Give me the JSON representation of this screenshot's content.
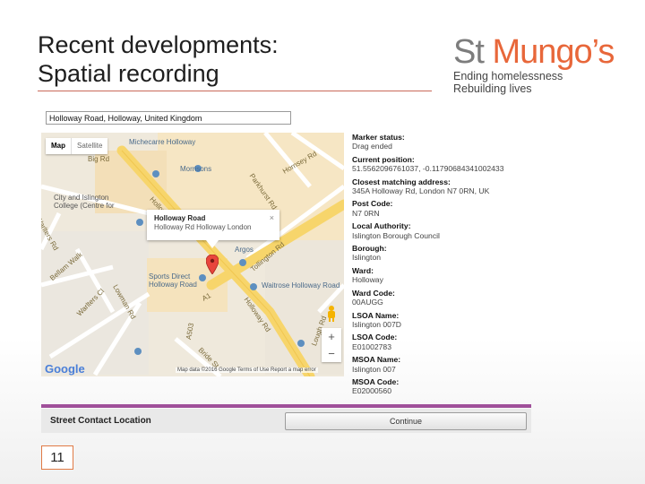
{
  "slide": {
    "title_line1": "Recent developments:",
    "title_line2": "Spatial recording",
    "page_number": "11"
  },
  "logo": {
    "word_st": "St ",
    "word_mungo": "Mungo’s",
    "tag1": "Ending homelessness",
    "tag2": "Rebuilding lives",
    "color_grey": "#7d7d7d",
    "color_orange": "#e8673a"
  },
  "search": {
    "value": "Holloway Road, Holloway, United Kingdom"
  },
  "map": {
    "type_map": "Map",
    "type_satellite": "Satellite",
    "labels": {
      "michecarre": "Michecarre Holloway",
      "morrisons": "Morrisons",
      "big_rd": "Big Rd",
      "city_islington": "City and Islington",
      "college": "College (Centre for",
      "warlters_rd": "Warlters Rd",
      "bellam": "Bellam Walk",
      "sports_direct": "Sports Direct",
      "sports_direct2": "Holloway Road",
      "argos": "Argos",
      "waitrose": "Waitrose Holloway Road",
      "tollington": "Tollington Rd",
      "holloway_rd": "Holloway Rd",
      "holloway_rd2": "Holloway Rd",
      "a1": "A1",
      "a503": "A503",
      "warlters2": "Warlters Cl",
      "parkhurst": "Parkhurst Rd",
      "hornsey": "Hornsey Rd",
      "lowman": "Lowman Rd",
      "bride": "Bride St",
      "lough": "Lough Rd"
    },
    "popup_title": "Holloway Road",
    "popup_sub": "Holloway Rd Holloway London",
    "popup_close": "×",
    "zoom_in": "+",
    "zoom_out": "−",
    "google": "Google",
    "attribution": "Map data ©2016 Google   Terms of Use   Report a map error"
  },
  "info": {
    "marker_status_label": "Marker status:",
    "marker_status_value": "Drag ended",
    "current_position_label": "Current position:",
    "current_position_value": "51.5562096761037, -0.11790684341002433",
    "closest_label": "Closest matching address:",
    "closest_value": "345A Holloway Rd, London N7 0RN, UK",
    "post_code_label": "Post Code:",
    "post_code_value": "N7 0RN",
    "local_authority_label": "Local Authority:",
    "local_authority_value": "Islington Borough Council",
    "borough_label": "Borough:",
    "borough_value": "Islington",
    "ward_label": "Ward:",
    "ward_value": "Holloway",
    "ward_code_label": "Ward Code:",
    "ward_code_value": "00AUGG",
    "lsoa_name_label": "LSOA Name:",
    "lsoa_name_value": "Islington 007D",
    "lsoa_code_label": "LSOA Code:",
    "lsoa_code_value": "E01002783",
    "msoa_name_label": "MSOA Name:",
    "msoa_name_value": "Islington 007",
    "msoa_code_label": "MSOA Code:",
    "msoa_code_value": "E02000560"
  },
  "bottom": {
    "street_contact_label": "Street Contact Location",
    "continue_label": "Continue"
  }
}
